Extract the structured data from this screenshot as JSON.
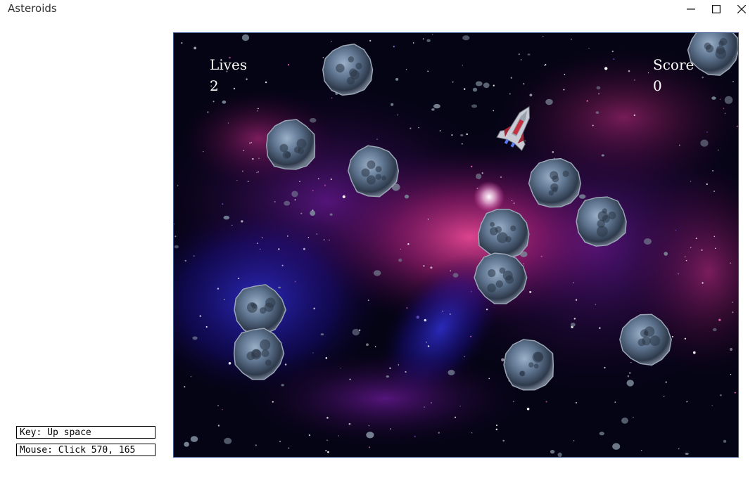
{
  "window": {
    "title": "Asteroids",
    "controls": {
      "minimize": "minimize-icon",
      "maximize": "maximize-icon",
      "close": "close-icon"
    }
  },
  "game": {
    "lives_label": "Lives",
    "lives_value": "2",
    "score_label": "Score",
    "score_value": "0",
    "colors": {
      "space": "#040414",
      "nebula_pink": "#c0206a",
      "nebula_blue": "#2a2ad0",
      "asteroid": "#5f7590",
      "frame_border": "#3c5b92"
    }
  },
  "status": {
    "key_text": "Key: Up space",
    "mouse_text": "Mouse: Click 570, 165"
  }
}
